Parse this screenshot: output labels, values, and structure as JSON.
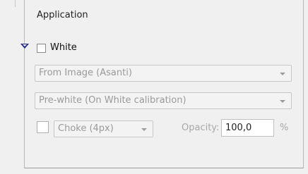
{
  "section": {
    "title": "Application"
  },
  "white": {
    "label": "White",
    "checked": false,
    "expanded": true
  },
  "source_select": {
    "value": "From Image (Asanti)"
  },
  "mode_select": {
    "value": "Pre-white (On White calibration)"
  },
  "choke": {
    "checked": false,
    "select_value": "Choke (4px)"
  },
  "opacity": {
    "label": "Opacity:",
    "value": "100,0",
    "unit": "%"
  },
  "colors": {
    "toggle": "#1f2a8c",
    "disabled_text": "#9a9a9a"
  }
}
